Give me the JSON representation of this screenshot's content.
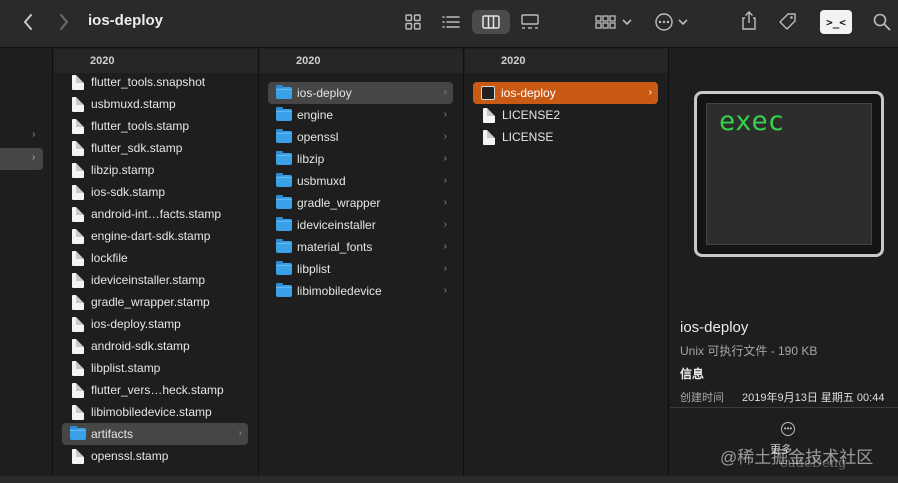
{
  "window": {
    "title": "ios-deploy"
  },
  "toolbar": {
    "back_icon": "chevron-left-icon",
    "forward_icon": "chevron-right-icon",
    "views": [
      "icon-view-icon",
      "list-view-icon",
      "column-view-icon",
      "gallery-view-icon"
    ],
    "terminal_label": ">_<"
  },
  "column1": {
    "header": "2020",
    "items": [
      {
        "label": "flutter_tools.snapshot",
        "type": "file"
      },
      {
        "label": "usbmuxd.stamp",
        "type": "file"
      },
      {
        "label": "flutter_tools.stamp",
        "type": "file"
      },
      {
        "label": "flutter_sdk.stamp",
        "type": "file"
      },
      {
        "label": "libzip.stamp",
        "type": "file"
      },
      {
        "label": "ios-sdk.stamp",
        "type": "file"
      },
      {
        "label": "android-int…facts.stamp",
        "type": "file"
      },
      {
        "label": "engine-dart-sdk.stamp",
        "type": "file"
      },
      {
        "label": "lockfile",
        "type": "file"
      },
      {
        "label": "ideviceinstaller.stamp",
        "type": "file"
      },
      {
        "label": "gradle_wrapper.stamp",
        "type": "file"
      },
      {
        "label": "ios-deploy.stamp",
        "type": "file"
      },
      {
        "label": "android-sdk.stamp",
        "type": "file"
      },
      {
        "label": "libplist.stamp",
        "type": "file"
      },
      {
        "label": "flutter_vers…heck.stamp",
        "type": "file"
      },
      {
        "label": "libimobiledevice.stamp",
        "type": "file"
      },
      {
        "label": "artifacts",
        "type": "folder",
        "selected": true
      },
      {
        "label": "openssl.stamp",
        "type": "file"
      }
    ]
  },
  "column2": {
    "header": "2020",
    "items": [
      {
        "label": "ios-deploy",
        "type": "folder",
        "selected": true
      },
      {
        "label": "engine",
        "type": "folder"
      },
      {
        "label": "openssl",
        "type": "folder"
      },
      {
        "label": "libzip",
        "type": "folder"
      },
      {
        "label": "usbmuxd",
        "type": "folder"
      },
      {
        "label": "gradle_wrapper",
        "type": "folder"
      },
      {
        "label": "ideviceinstaller",
        "type": "folder"
      },
      {
        "label": "material_fonts",
        "type": "folder"
      },
      {
        "label": "libplist",
        "type": "folder"
      },
      {
        "label": "libimobiledevice",
        "type": "folder"
      }
    ]
  },
  "column3": {
    "header": "2020",
    "items": [
      {
        "label": "ios-deploy",
        "type": "exec",
        "selected": true
      },
      {
        "label": "LICENSE2",
        "type": "file"
      },
      {
        "label": "LICENSE",
        "type": "file"
      }
    ]
  },
  "preview": {
    "thumb_text": "exec",
    "name": "ios-deploy",
    "kind": "Unix 可执行文件 - 190 KB",
    "info_heading": "信息",
    "created_label": "创建时间",
    "created_value": "2019年9月13日 星期五 00:44",
    "more_label": "更多"
  },
  "watermark": {
    "text": "@稀土掘金技术社区",
    "sub": "cudeDeng"
  },
  "colors": {
    "selection_orange": "#c95a14",
    "folder_blue": "#3aa0e8",
    "exec_green": "#35d14a"
  }
}
